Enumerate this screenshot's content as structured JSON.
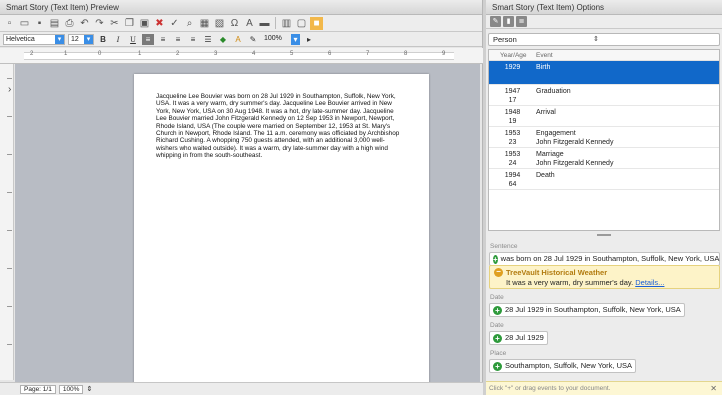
{
  "left_panel": {
    "title": "Smart Story (Text Item) Preview",
    "font_name": "Helvetica",
    "font_size": "12",
    "bold_label": "B",
    "italic_label": "I",
    "underline_label": "U",
    "zoom": "100%",
    "ruler_numbers": [
      "2",
      "1",
      "0",
      "1",
      "2",
      "3",
      "4",
      "5",
      "6",
      "7",
      "8",
      "9"
    ],
    "story_text": "Jacqueline Lee Bouvier was born on 28 Jul 1929 in Southampton, Suffolk, New York, USA. It was a very warm, dry summer's day. Jacqueline Lee Bouvier arrived in New York, New York, USA on 30 Aug 1948. It was a hot, dry late-summer day. Jacqueline Lee Bouvier married John Fitzgerald Kennedy on 12 Sep 1953 in Newport, Newport, Rhode Island, USA (The couple were married on September 12, 1953 at St. Mary's Church in Newport, Rhode Island. The 11 a.m. ceremony was officiated by Archbishop Richard Cushing. A whopping 750 guests attended, with an additional 3,000 well-wishers who waited outside). It was a warm, dry late-summer day with a high wind whipping in from the south-southeast.",
    "status": {
      "page": "Page: 1/1",
      "zoom": "100%"
    }
  },
  "right_panel": {
    "title": "Smart Story (Text Item) Options",
    "person_select": "Person",
    "events_header": {
      "year_age": "Year/Age",
      "event": "Event"
    },
    "events": [
      {
        "year": "1929",
        "age": "",
        "event": "Birth",
        "detail": "",
        "selected": true
      },
      {
        "year": "1947",
        "age": "17",
        "event": "Graduation",
        "detail": ""
      },
      {
        "year": "1948",
        "age": "19",
        "event": "Arrival",
        "detail": ""
      },
      {
        "year": "1953",
        "age": "23",
        "event": "Engagement",
        "detail": "John Fitzgerald Kennedy"
      },
      {
        "year": "1953",
        "age": "24",
        "event": "Marriage",
        "detail": "John Fitzgerald Kennedy"
      },
      {
        "year": "1994",
        "age": "64",
        "event": "Death",
        "detail": ""
      }
    ],
    "sentence_label": "Sentence",
    "sentence_chip": "was born on 28 Jul 1929 in Southampton, Suffolk, New York, USA",
    "weather_title": "TreeVault Historical Weather",
    "weather_text": "It was a very warm, dry summer's day.",
    "weather_link": "Details...",
    "date_label_1": "Date",
    "date_chip_1": "28 Jul 1929 in Southampton, Suffolk, New York, USA",
    "date_label_2": "Date",
    "date_chip_2": "28 Jul 1929",
    "place_label": "Place",
    "place_chip": "Southampton, Suffolk, New York, USA",
    "hint": "Click \"+\" or drag events to your document."
  }
}
